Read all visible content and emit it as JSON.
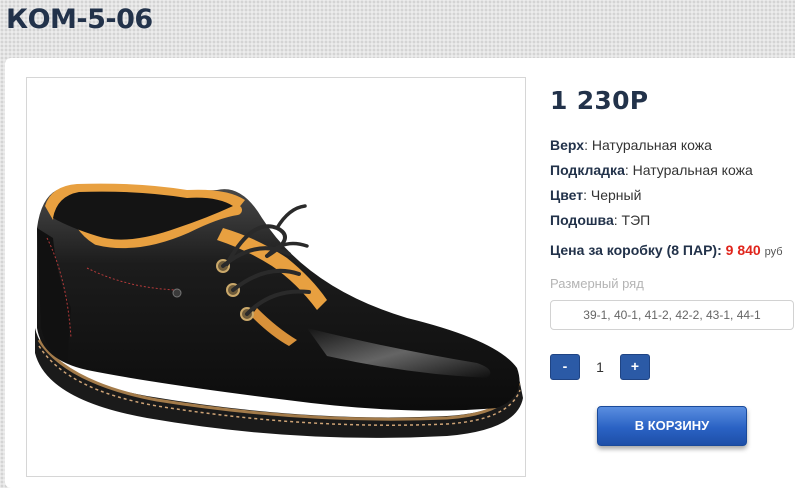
{
  "product": {
    "title": "КОМ-5-06",
    "price": "1 230Р"
  },
  "specs": [
    {
      "key": "Верх",
      "value": "Натуральная кожа"
    },
    {
      "key": "Подкладка",
      "value": "Натуральная кожа"
    },
    {
      "key": "Цвет",
      "value": "Черный"
    },
    {
      "key": "Подошва",
      "value": "ТЭП"
    }
  ],
  "box_price": {
    "label": "Цена за коробку (8 ПАР):",
    "value": "9 840",
    "currency": "руб"
  },
  "size": {
    "label": "Размерный ряд",
    "value": "39-1, 40-1, 41-2, 42-2, 43-1, 44-1"
  },
  "quantity": {
    "minus": "-",
    "value": "1",
    "plus": "+"
  },
  "cart_button": "В КОРЗИНУ",
  "colors": {
    "title": "#22324a",
    "accent": "#2b5aa6",
    "price_red": "#e0241b"
  }
}
